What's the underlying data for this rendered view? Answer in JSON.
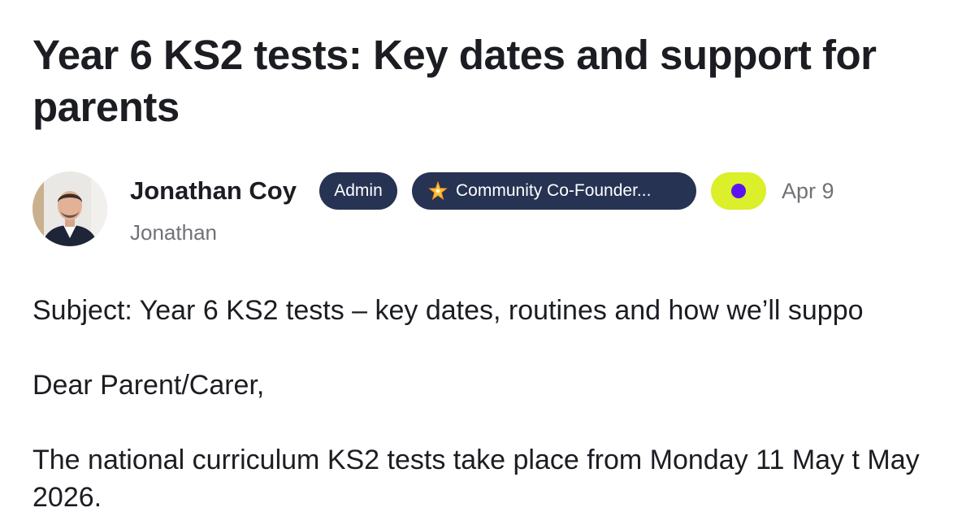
{
  "post": {
    "title": "Year 6 KS2 tests: Key dates and support for parents",
    "author": {
      "name": "Jonathan Coy",
      "username": "Jonathan",
      "avatar": "profile-photo-icon"
    },
    "badges": [
      {
        "label": "Admin"
      },
      {
        "label": "Community Co-Founder...",
        "icon": "sparkle-star-icon"
      }
    ],
    "status_pill": {
      "icon": "purple-dot-icon",
      "color": "#dbef2a"
    },
    "date": "Apr 9",
    "body": {
      "subject": "Subject: Year 6 KS2 tests – key dates, routines and how we’ll suppo",
      "greeting": "Dear Parent/Carer,",
      "intro": "The national curriculum KS2 tests take place from Monday 11 May t May 2026."
    }
  },
  "colors": {
    "badge_bg": "#263353",
    "status_dot": "#5b14f0",
    "muted_text": "#707277"
  }
}
